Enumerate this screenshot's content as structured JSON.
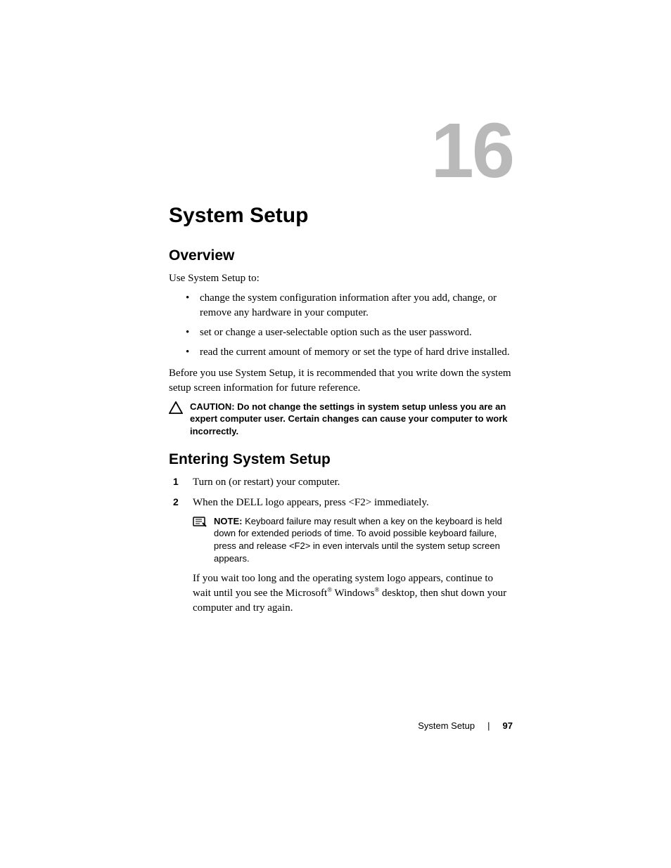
{
  "chapter_number": "16",
  "title": "System Setup",
  "overview": {
    "heading": "Overview",
    "intro": "Use System Setup to:",
    "bullets": [
      "change the system configuration information after you add, change, or remove any hardware in your computer.",
      "set or change a user-selectable option such as the user password.",
      "read the current amount of memory or set the type of hard drive installed."
    ],
    "after_bullets": "Before you use System Setup, it is recommended that you write down the system setup screen information for future reference.",
    "caution_label": "CAUTION: ",
    "caution_text": "Do not change the settings in system setup unless you are an expert computer user. Certain changes can cause your computer to work incorrectly."
  },
  "entering": {
    "heading": "Entering System Setup",
    "step1": "Turn on (or restart) your computer.",
    "step2": "When the DELL logo appears, press <F2> immediately.",
    "note_label": "NOTE: ",
    "note_text": "Keyboard failure may result when a key on the keyboard is held down for extended periods of time. To avoid possible keyboard failure, press and release <F2> in even intervals until the system setup screen appears.",
    "tail_pre": "If you wait too long and the operating system logo appears, continue to wait until you see the Microsoft",
    "tail_mid": " Windows",
    "tail_post": " desktop, then shut down your computer and try again."
  },
  "footer": {
    "section": "System Setup",
    "page": "97"
  }
}
